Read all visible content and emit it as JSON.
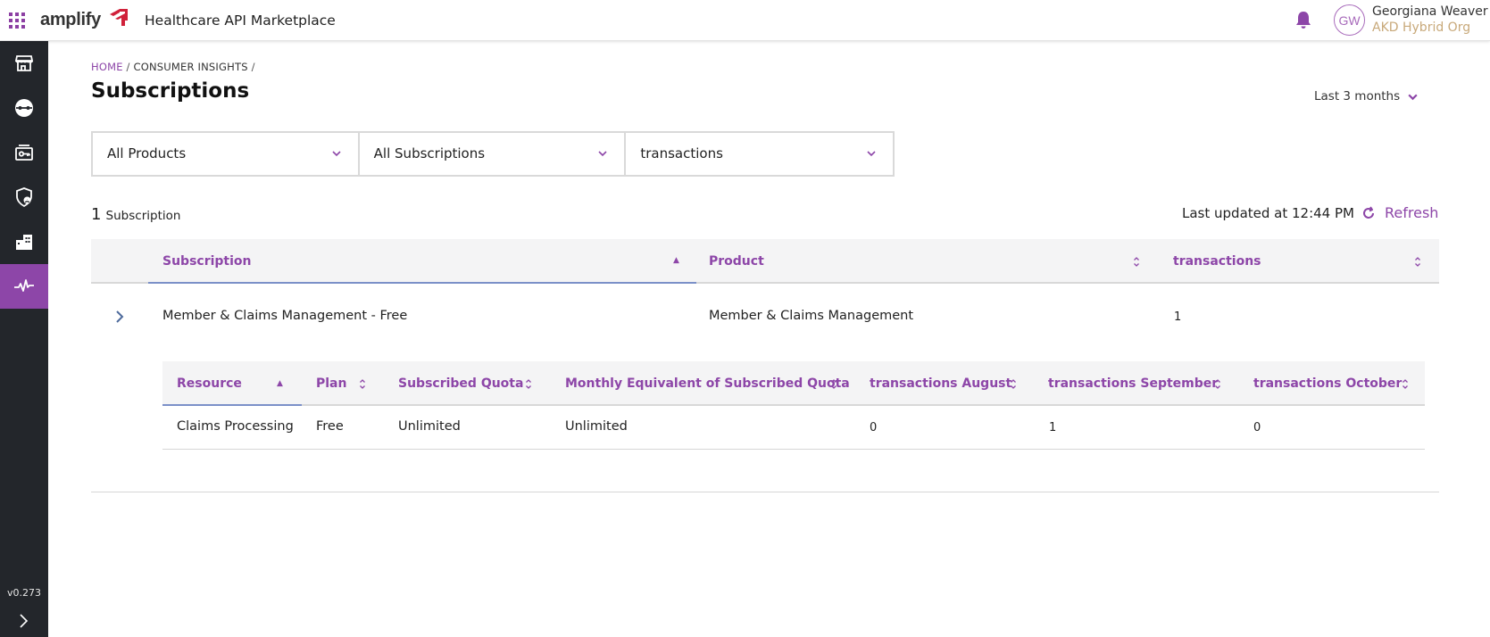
{
  "header": {
    "brand": "amplify",
    "app_title": "Healthcare API Marketplace",
    "user": {
      "initials": "GW",
      "name": "Georgiana Weaver",
      "org": "AKD Hybrid Org"
    }
  },
  "sidebar": {
    "items": [
      {
        "icon": "storefront-icon"
      },
      {
        "icon": "api-connection-icon"
      },
      {
        "icon": "key-card-icon"
      },
      {
        "icon": "shield-user-icon"
      },
      {
        "icon": "organization-icon"
      },
      {
        "icon": "activity-pulse-icon",
        "active": true
      }
    ],
    "version": "v0.273"
  },
  "breadcrumb": {
    "home": "HOME",
    "separator": "/",
    "section": "CONSUMER INSIGHTS"
  },
  "page_title": "Subscriptions",
  "time_range": "Last 3 months",
  "filters": [
    {
      "label": "All Products"
    },
    {
      "label": "All Subscriptions"
    },
    {
      "label": "transactions"
    }
  ],
  "summary": {
    "count": "1",
    "count_label": "Subscription",
    "last_updated": "Last updated at 12:44 PM",
    "refresh_label": "Refresh"
  },
  "table": {
    "columns": [
      "Subscription",
      "Product",
      "transactions"
    ],
    "rows": [
      {
        "subscription": "Member & Claims Management - Free",
        "product": "Member & Claims Management",
        "transactions": "1"
      }
    ]
  },
  "nested_table": {
    "columns": [
      "Resource",
      "Plan",
      "Subscribed Quota",
      "Monthly Equivalent of Subscribed Quota",
      "transactions August",
      "transactions September",
      "transactions October"
    ],
    "rows": [
      [
        "Claims Processing",
        "Free",
        "Unlimited",
        "Unlimited",
        "0",
        "1",
        "0"
      ]
    ]
  },
  "colors": {
    "accent": "#8d46a8",
    "sidebar": "#23262b",
    "org_text": "#c8a97a"
  }
}
